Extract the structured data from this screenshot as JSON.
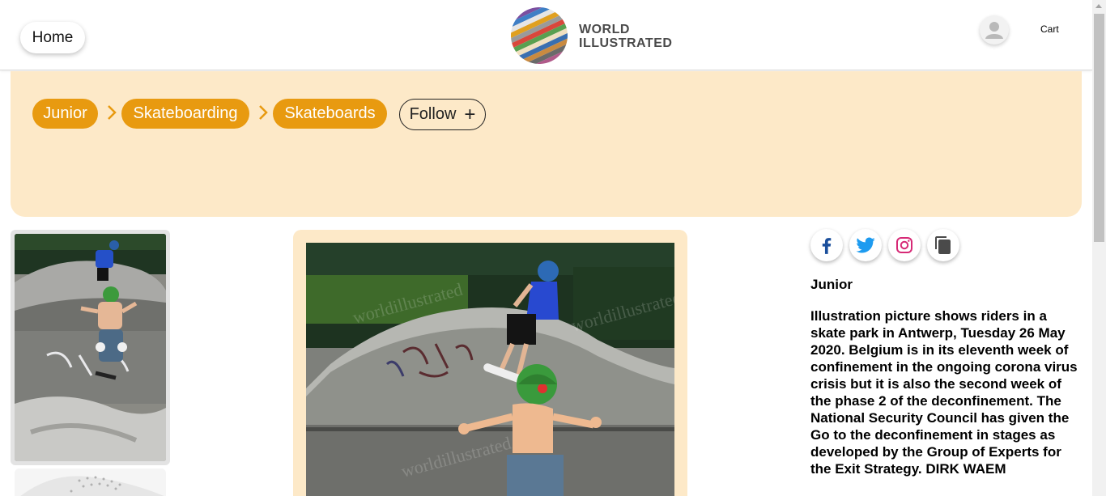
{
  "header": {
    "home_label": "Home",
    "logo_line1": "WORLD",
    "logo_line2": "ILLUSTRATED",
    "cart_label": "Cart"
  },
  "breadcrumb": {
    "items": [
      {
        "label": "Junior"
      },
      {
        "label": "Skateboarding"
      },
      {
        "label": "Skateboards"
      }
    ],
    "follow_label": "Follow"
  },
  "share": {
    "icons": [
      "facebook-icon",
      "twitter-icon",
      "instagram-icon",
      "copy-icon"
    ]
  },
  "photo": {
    "watermark": "worldillustrated"
  },
  "details": {
    "category": "Junior",
    "caption": "Illustration picture shows riders in a skate park in Antwerp, Tuesday 26 May 2020. Belgium is in its eleventh week of confinement in the ongoing corona virus crisis but it is also the second week of the phase 2 of the deconfinement. The National Security Council has given the Go to the deconfinement in stages as developed by the Group of Experts for the Exit Strategy. DIRK WAEM"
  },
  "colors": {
    "accent": "#e89a10",
    "banner_bg": "#fde9c8",
    "facebook": "#1b4f9c",
    "twitter": "#1d9bf0",
    "instagram": "#d62976"
  }
}
